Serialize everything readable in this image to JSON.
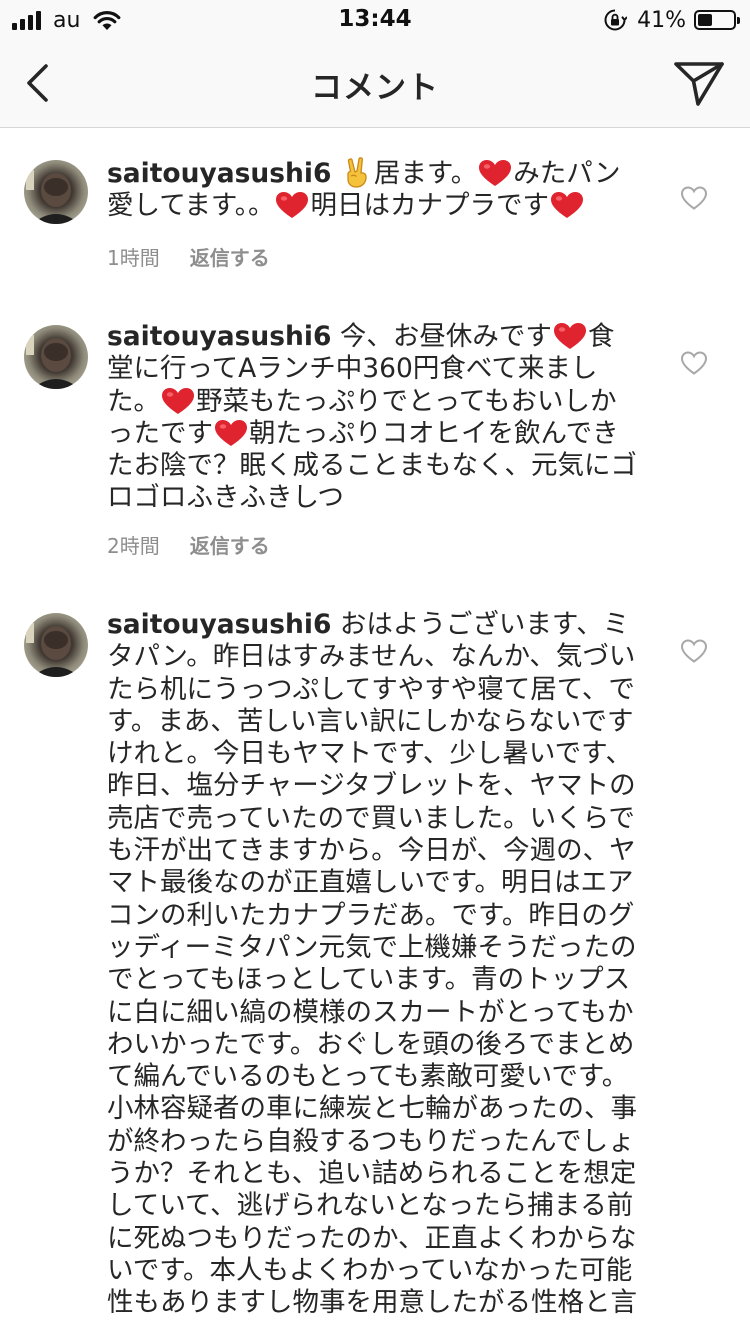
{
  "status_bar": {
    "carrier": "au",
    "time": "13:44",
    "battery_percent_label": "41%",
    "battery_level": 0.41
  },
  "nav": {
    "title": "コメント",
    "back_icon": "chevron-left-icon",
    "send_icon": "paper-plane-icon"
  },
  "comments": [
    {
      "username": "saitouyasushi6",
      "segments": [
        {
          "type": "emoji",
          "icon": "victory-hand-icon"
        },
        {
          "type": "text",
          "text": "居ます。"
        },
        {
          "type": "emoji",
          "icon": "red-heart-icon"
        },
        {
          "type": "text",
          "text": "みたパン愛してます。。"
        },
        {
          "type": "emoji",
          "icon": "red-heart-icon"
        },
        {
          "type": "text",
          "text": "明日はカナプラです"
        },
        {
          "type": "emoji",
          "icon": "red-heart-icon"
        }
      ],
      "time": "1時間",
      "reply_label": "返信する"
    },
    {
      "username": "saitouyasushi6",
      "segments": [
        {
          "type": "text",
          "text": "今、お昼休みです"
        },
        {
          "type": "emoji",
          "icon": "red-heart-icon"
        },
        {
          "type": "text",
          "text": "食堂に行ってAランチ中360円食べて来ました。"
        },
        {
          "type": "emoji",
          "icon": "red-heart-icon"
        },
        {
          "type": "text",
          "text": "野菜もたっぷりでとってもおいしかったです"
        },
        {
          "type": "emoji",
          "icon": "red-heart-icon"
        },
        {
          "type": "text",
          "text": "朝たっぷりコオヒイを飲んできたお陰で？眠く成ることまもなく、元気にゴロゴロふきふきしつ"
        }
      ],
      "time": "2時間",
      "reply_label": "返信する"
    },
    {
      "username": "saitouyasushi6",
      "segments": [
        {
          "type": "text",
          "text": "おはようございます、ミタパン。昨日はすみません、なんか、気づいたら机にうっつぷしてすやすや寝て居て、です。まあ、苦しい言い訳にしかならないですけれと。今日もヤマトです、少し暑いです、昨日、塩分チャージタブレットを、ヤマトの売店で売っていたので買いました。いくらでも汗が出てきますから。今日が、今週の、ヤマト最後なのが正直嬉しいです。明日はエアコンの利いたカナプラだあ。です。昨日のグッディーミタパン元気で上機嫌そうだったのでとってもほっとしています。青のトップスに白に細い縞の模様のスカートがとってもかわいかったです。おぐしを頭の後ろでまとめて編んでいるのもとっても素敵可愛いです。小林容疑者の車に練炭と七輪があったの、事が終わったら自殺するつもりだったんでしょうか？それとも、追い詰められることを想定していて、逃げられないとなったら捕まる前に死ぬつもりだったのか、正直よくわからないです。本人もよくわかっていなかった可能性もありますし物事を用意したがる性格と言"
        }
      ],
      "time": "",
      "reply_label": ""
    }
  ]
}
